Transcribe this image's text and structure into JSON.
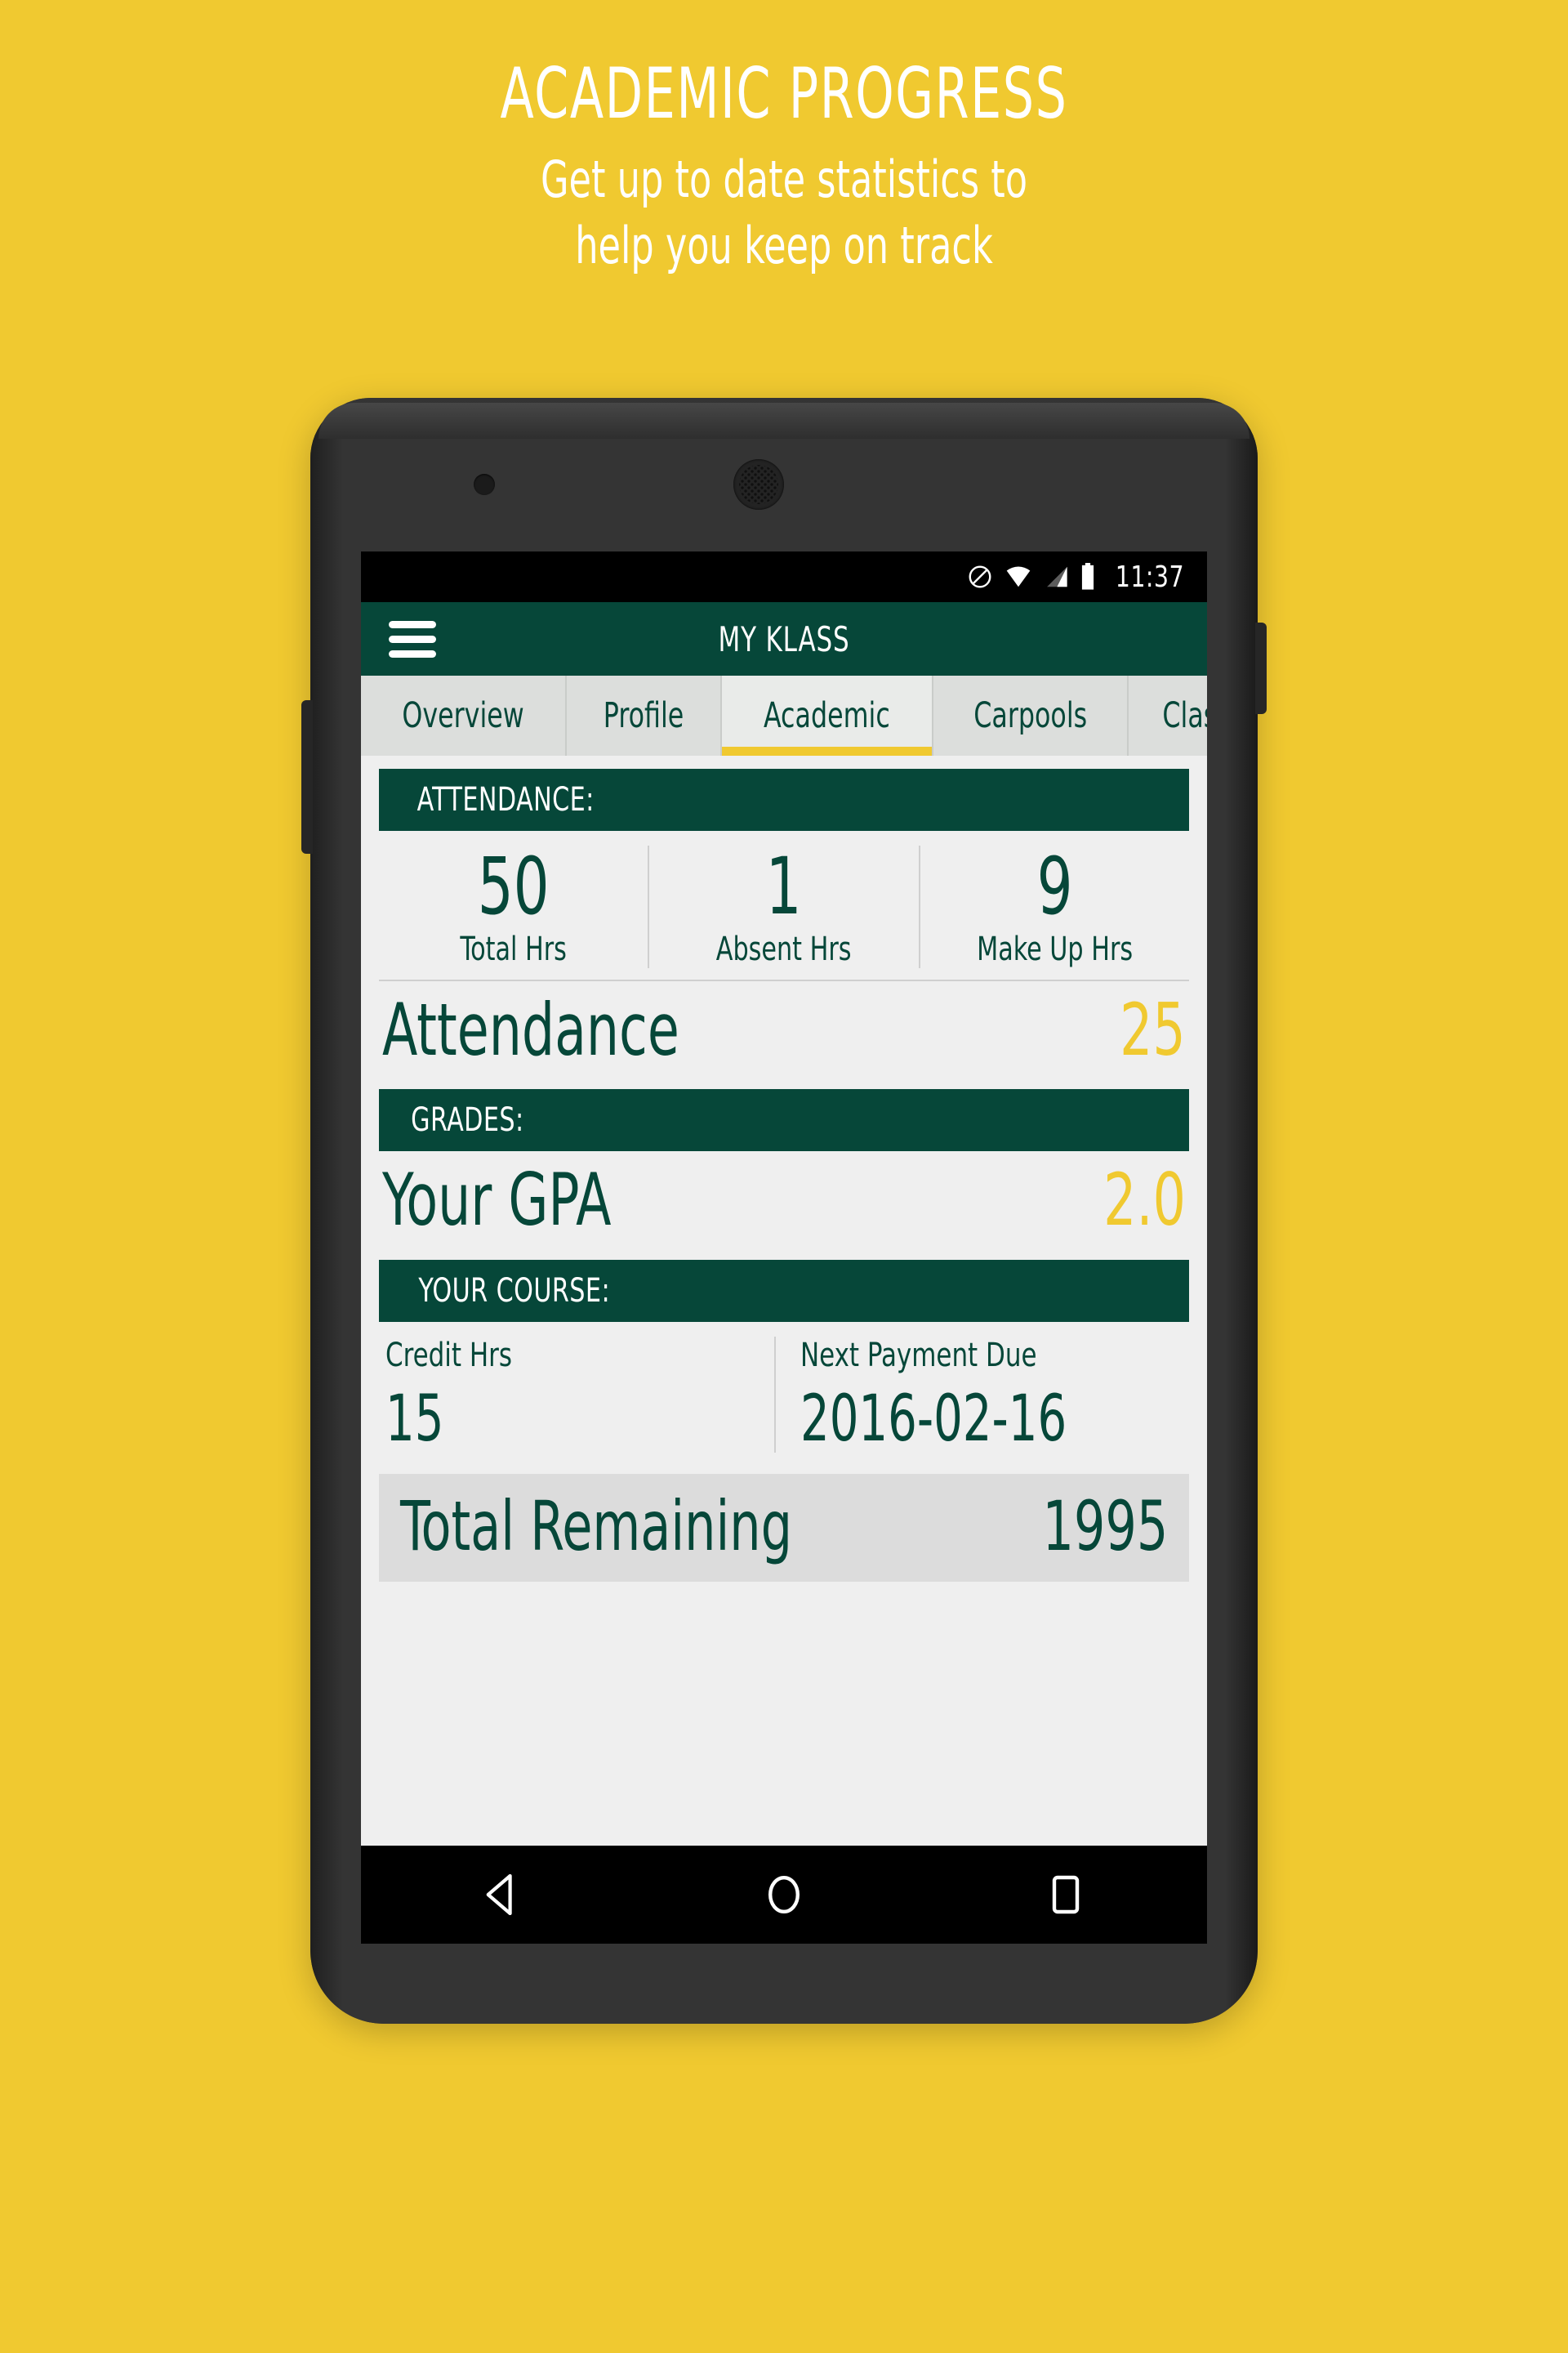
{
  "promo": {
    "title": "ACADEMIC PROGRESS",
    "subtitle_line1": "Get up to date statistics to",
    "subtitle_line2": "help you keep on track"
  },
  "colors": {
    "background_yellow": "#F0C930",
    "brand_teal": "#064739",
    "accent_yellow": "#F0C930",
    "screen_bg": "#EFEFEF",
    "tab_bar_bg": "#DCDEDC",
    "phone_body": "#2E2E2E"
  },
  "statusbar": {
    "time": "11:37",
    "icons": [
      "do-not-disturb-icon",
      "wifi-icon",
      "cellular-signal-icon",
      "battery-icon"
    ]
  },
  "appbar": {
    "title": "MY KLASS",
    "menu_icon": "hamburger-menu-icon"
  },
  "tabs": [
    {
      "label": "Overview",
      "active": false
    },
    {
      "label": "Profile",
      "active": false
    },
    {
      "label": "Academic",
      "active": true
    },
    {
      "label": "Carpools",
      "active": false
    },
    {
      "label": "Clas",
      "active": false
    }
  ],
  "attendance": {
    "header": "ATTENDANCE:",
    "stats": [
      {
        "value": "50",
        "label": "Total Hrs"
      },
      {
        "value": "1",
        "label": "Absent Hrs"
      },
      {
        "value": "9",
        "label": "Make Up Hrs"
      }
    ],
    "summary_key": "Attendance",
    "summary_value": "25"
  },
  "grades": {
    "header": "GRADES:",
    "gpa_key": "Your GPA",
    "gpa_value": "2.0"
  },
  "course": {
    "header": "YOUR COURSE:",
    "credit_hrs_label": "Credit Hrs",
    "credit_hrs_value": "15",
    "next_payment_label": "Next Payment Due",
    "next_payment_value": "2016-02-16",
    "total_remaining_label": "Total Remaining",
    "total_remaining_value": "1995"
  },
  "navbar": {
    "back": "back-triangle-icon",
    "home": "home-circle-icon",
    "recents": "recents-square-icon"
  }
}
